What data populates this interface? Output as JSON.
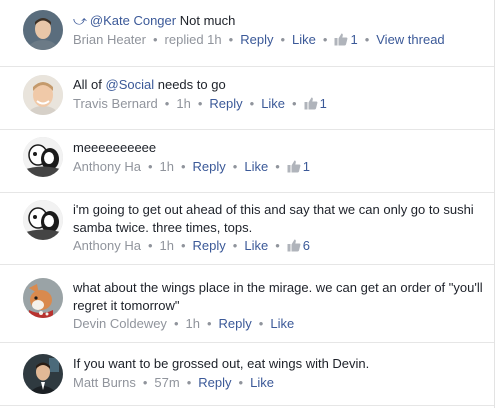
{
  "comments": [
    {
      "reply_to_prefix": "⤻",
      "mention": "@Kate Conger",
      "text": " Not much",
      "author": "Brian Heater",
      "time": "replied 1h",
      "reply_label": "Reply",
      "like_label": "Like",
      "like_count": "1",
      "view_thread_label": "View thread",
      "avatar_colors": {
        "bg": "#5a6d7d",
        "face": "#e8c6a8",
        "hair": "#3e3126",
        "shirt": "#6b7a86"
      }
    },
    {
      "text_before": "All of ",
      "mention": "@Social",
      "text_after": " needs to go",
      "author": "Travis Bernard",
      "time": "1h",
      "reply_label": "Reply",
      "like_label": "Like",
      "like_count": "1",
      "avatar_colors": {
        "bg": "#e9e4dc",
        "face": "#f0c9a8",
        "hair": "#c49a6c",
        "shirt": "#d6d0c8"
      }
    },
    {
      "text": "meeeeeeeeee",
      "author": "Anthony Ha",
      "time": "1h",
      "reply_label": "Reply",
      "like_label": "Like",
      "like_count": "1",
      "avatar_colors": {
        "bg": "#f2f2f2",
        "face": "#ffffff",
        "hair": "#1a1a1a",
        "shirt": "#444444"
      }
    },
    {
      "text": "i'm going to get out ahead of this and say that we can only go to sushi samba twice. three times, tops.",
      "author": "Anthony Ha",
      "time": "1h",
      "reply_label": "Reply",
      "like_label": "Like",
      "like_count": "6",
      "avatar_colors": {
        "bg": "#f2f2f2",
        "face": "#ffffff",
        "hair": "#1a1a1a",
        "shirt": "#444444"
      }
    },
    {
      "text": "what about the wings place in the mirage. we can get an order of \"you'll regret it tomorrow\"",
      "author": "Devin Coldewey",
      "time": "1h",
      "reply_label": "Reply",
      "like_label": "Like",
      "avatar_colors": {
        "bg": "#9aa3a6",
        "face": "#d98a4e",
        "hair": "#f5f1ea",
        "shirt": "#b8322f"
      }
    },
    {
      "text": "If you want to be grossed out, eat wings with Devin.",
      "author": "Matt Burns",
      "time": "57m",
      "reply_label": "Reply",
      "like_label": "Like",
      "avatar_colors": {
        "bg": "#2f3a40",
        "face": "#e1b896",
        "hair": "#2a1d14",
        "shirt": "#1b2024"
      }
    }
  ],
  "separator": "•",
  "colors": {
    "link": "#3b5998",
    "meta": "#90949c",
    "text": "#1d2129",
    "divider": "#e6e6e6"
  }
}
